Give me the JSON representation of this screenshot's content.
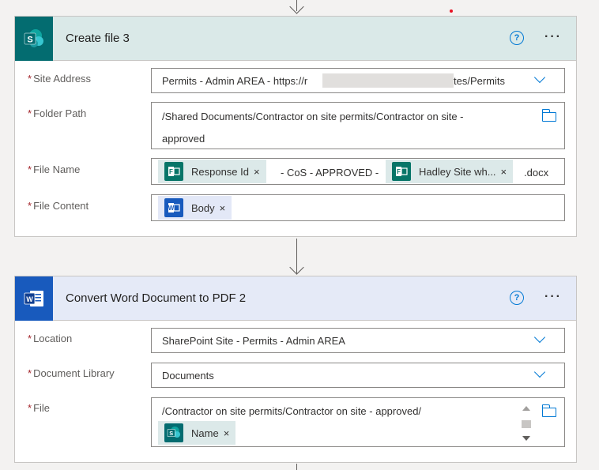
{
  "create_file": {
    "title": "Create file 3",
    "fields": {
      "site_address": {
        "label": "Site Address",
        "value": "Permits - Admin AREA - https://r",
        "value_suffix": "tes/Permits"
      },
      "folder_path": {
        "label": "Folder Path",
        "line1": "/Shared Documents/Contractor on site permits/Contractor on site -",
        "line2": "approved"
      },
      "file_name": {
        "label": "File Name",
        "token1": "Response Id",
        "sep": "- CoS - APPROVED -",
        "token2": "Hadley Site wh...",
        "suffix": ".docx"
      },
      "file_content": {
        "label": "File Content",
        "token": "Body"
      }
    }
  },
  "convert": {
    "title": "Convert Word Document to PDF 2",
    "fields": {
      "location": {
        "label": "Location",
        "value": "SharePoint Site - Permits - Admin AREA"
      },
      "document_library": {
        "label": "Document Library",
        "value": "Documents"
      },
      "file": {
        "label": "File",
        "line1": "/Contractor on site permits/Contractor on site - approved/",
        "token": "Name"
      }
    }
  },
  "common": {
    "required_mark": "*",
    "help_glyph": "?",
    "more_glyph": "···",
    "remove_glyph": "×"
  },
  "icons": {
    "sharepoint": "sharepoint-icon",
    "word": "word-icon",
    "forms": "forms-icon"
  },
  "colors": {
    "sharepoint": "#036c70",
    "word": "#185abd",
    "forms": "#077568",
    "accent": "#0078d4",
    "required": "#a4262c"
  }
}
